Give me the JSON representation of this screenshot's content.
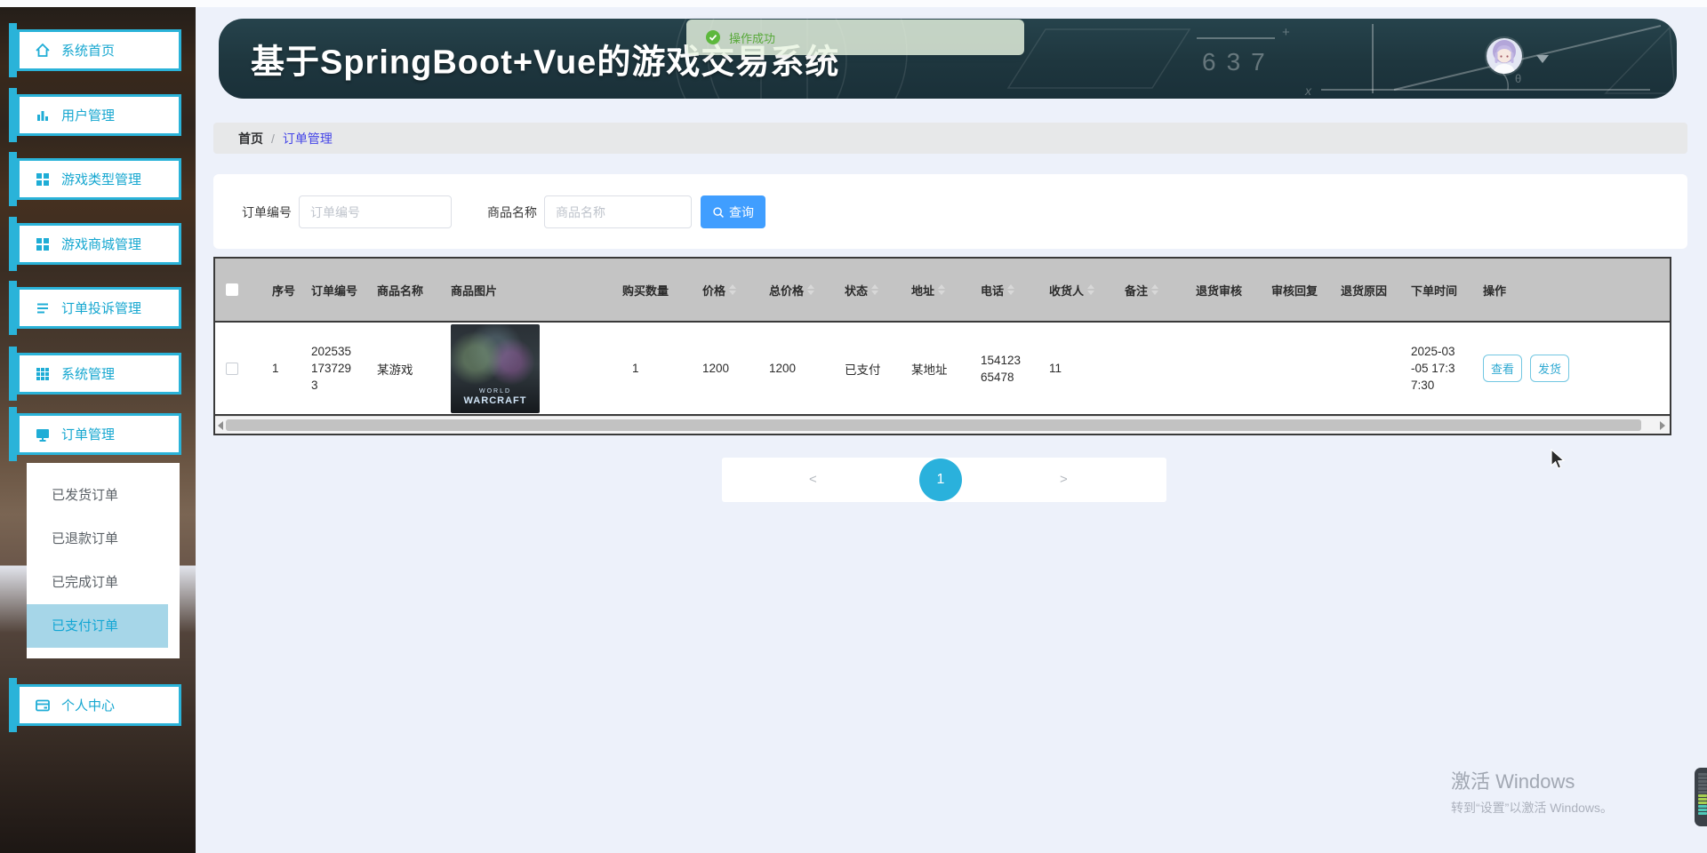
{
  "app": {
    "title": "基于SpringBoot+Vue的游戏交易系统"
  },
  "toast": {
    "text": "操作成功"
  },
  "header_board": {
    "number": "637",
    "plus": "+",
    "x_label": "x",
    "theta": "θ"
  },
  "sidebar": {
    "items": [
      {
        "label": "系统首页",
        "icon": "home-icon"
      },
      {
        "label": "用户管理",
        "icon": "bar-chart-icon"
      },
      {
        "label": "游戏类型管理",
        "icon": "grid-icon"
      },
      {
        "label": "游戏商城管理",
        "icon": "grid-icon"
      },
      {
        "label": "订单投诉管理",
        "icon": "list-icon"
      },
      {
        "label": "系统管理",
        "icon": "grid-9-icon"
      },
      {
        "label": "订单管理",
        "icon": "monitor-icon"
      }
    ],
    "submenu": {
      "items": [
        "已发货订单",
        "已退款订单",
        "已完成订单",
        "已支付订单"
      ],
      "active": "已支付订单"
    },
    "profile": {
      "label": "个人中心",
      "icon": "card-icon"
    }
  },
  "breadcrumb": {
    "home": "首页",
    "separator": "/",
    "current": "订单管理"
  },
  "search": {
    "fields": [
      {
        "label": "订单编号",
        "placeholder": "订单编号",
        "value": ""
      },
      {
        "label": "商品名称",
        "placeholder": "商品名称",
        "value": ""
      }
    ],
    "query_label": "查询"
  },
  "table": {
    "columns": [
      "",
      "序号",
      "订单编号",
      "商品名称",
      "商品图片",
      "购买数量",
      "价格",
      "总价格",
      "状态",
      "地址",
      "电话",
      "收货人",
      "备注",
      "退货审核",
      "审核回复",
      "退货原因",
      "下单时间",
      "操作"
    ],
    "row": {
      "index": "1",
      "order_no": "2025351737293",
      "product_name": "某游戏",
      "product_image": {
        "caption_line1": "WORLD",
        "caption_line2": "WARCRAFT"
      },
      "quantity": "1",
      "price": "1200",
      "total_price": "1200",
      "status": "已支付",
      "address": "某地址",
      "phone": "15412365478",
      "receiver": "11",
      "remark": "",
      "return_review": "",
      "review_reply": "",
      "return_reason": "",
      "order_time": "2025-03-05 17:37:30",
      "actions": [
        "查看",
        "发货"
      ]
    }
  },
  "pagination": {
    "prev": "<",
    "page": "1",
    "next": ">"
  },
  "watermark": {
    "line1": "激活 Windows",
    "line2": "转到“设置”以激活 Windows。"
  },
  "colors": {
    "accent_cyan": "#2ab3d9",
    "primary_blue": "#409eff",
    "success_green": "#67c23a",
    "breadcrumb_active": "#4444e8",
    "header_bg": "#1e343c",
    "pagination_active": "#2ab1dc",
    "table_header_bg": "#c4c4c4"
  }
}
